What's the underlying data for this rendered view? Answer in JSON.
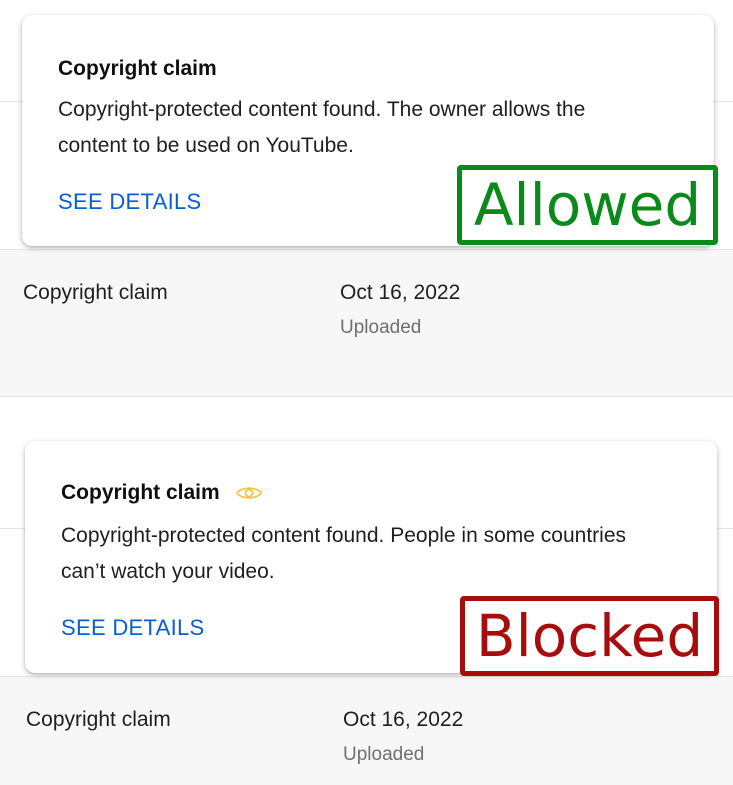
{
  "claims": [
    {
      "card": {
        "title": "Copyright claim",
        "description_line1": "Copyright-protected content found. The owner allows the",
        "description_line2": "content to be used on YouTube.",
        "link": "SEE DETAILS"
      },
      "tag": "Allowed",
      "row": {
        "type": "Copyright claim",
        "date": "Oct 16, 2022",
        "status": "Uploaded"
      }
    },
    {
      "card": {
        "title": "Copyright claim",
        "icon": "eye-icon",
        "description_line1": "Copyright-protected content found. People in some countries",
        "description_line2": "can’t watch your video.",
        "link": "SEE DETAILS"
      },
      "tag": "Blocked",
      "row": {
        "type": "Copyright claim",
        "date": "Oct 16, 2022",
        "status": "Uploaded"
      }
    }
  ],
  "colors": {
    "link": "#065fd4",
    "allowed": "#0a8a1a",
    "blocked": "#a80d0d",
    "eye_icon": "#f2c230"
  }
}
